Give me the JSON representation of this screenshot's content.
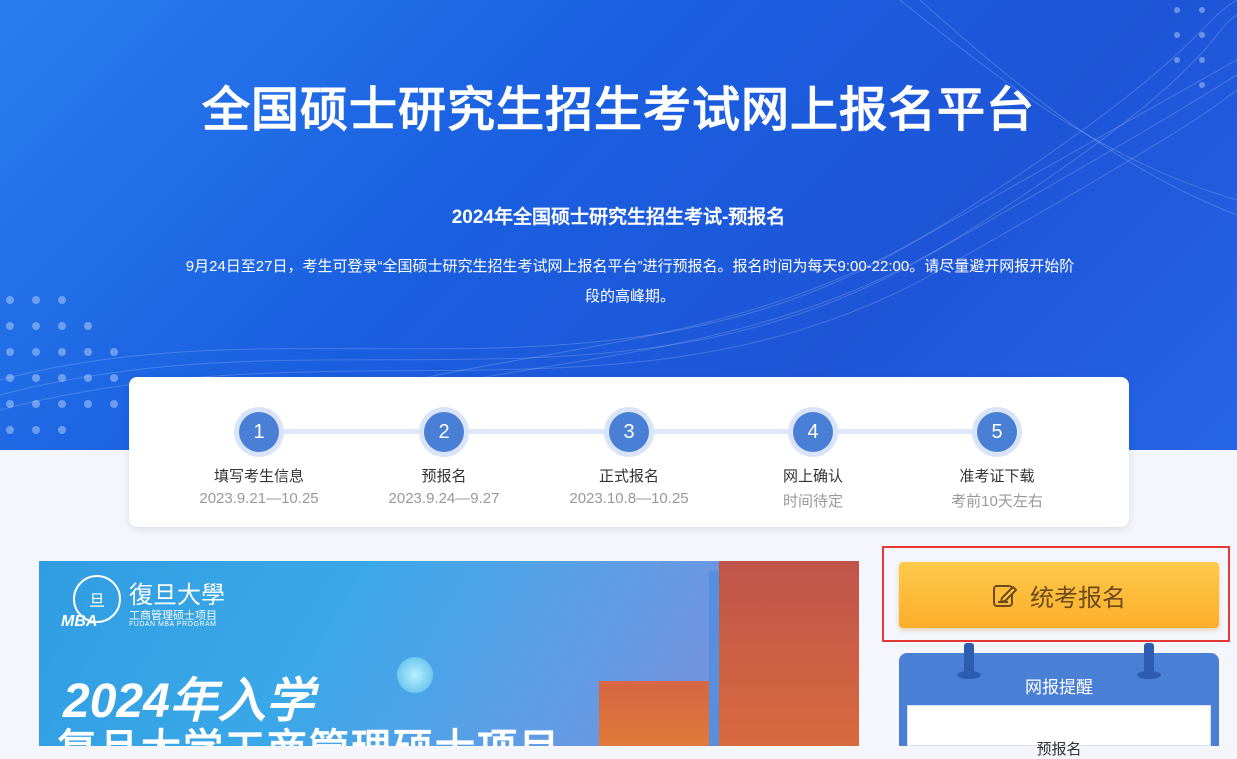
{
  "hero": {
    "title": "全国硕士研究生招生考试网上报名平台",
    "subtitle": "2024年全国硕士研究生招生考试-预报名",
    "description": "9月24日至27日，考生可登录“全国硕士研究生招生考试网上报名平台”进行预报名。报名时间为每天9:00-22:00。请尽量避开网报开始阶段的高峰期。"
  },
  "steps": [
    {
      "number": "1",
      "name": "填写考生信息",
      "date": "2023.9.21—10.25"
    },
    {
      "number": "2",
      "name": "预报名",
      "date": "2023.9.24—9.27"
    },
    {
      "number": "3",
      "name": "正式报名",
      "date": "2023.10.8—10.25"
    },
    {
      "number": "4",
      "name": "网上确认",
      "date": "时间待定"
    },
    {
      "number": "5",
      "name": "准考证下载",
      "date": "考前10天左右"
    }
  ],
  "banner": {
    "logo_cn": "復旦大學",
    "logo_sub": "工商管理硕士项目",
    "logo_en": "FUDAN MBA PROGRAM",
    "logo_mba": "MBA",
    "seal_text": "旦",
    "year_text": "2024年入学",
    "title": "复旦大学工商管理硕士项目"
  },
  "register_button": {
    "label": "统考报名",
    "icon": "edit-icon"
  },
  "notice": {
    "title": "网报提醒",
    "item": "预报名"
  },
  "colors": {
    "hero_blue": "#1a5fe0",
    "step_blue": "#4a7fd6",
    "button_orange": "#fcae2b",
    "highlight_red": "#e53935"
  }
}
